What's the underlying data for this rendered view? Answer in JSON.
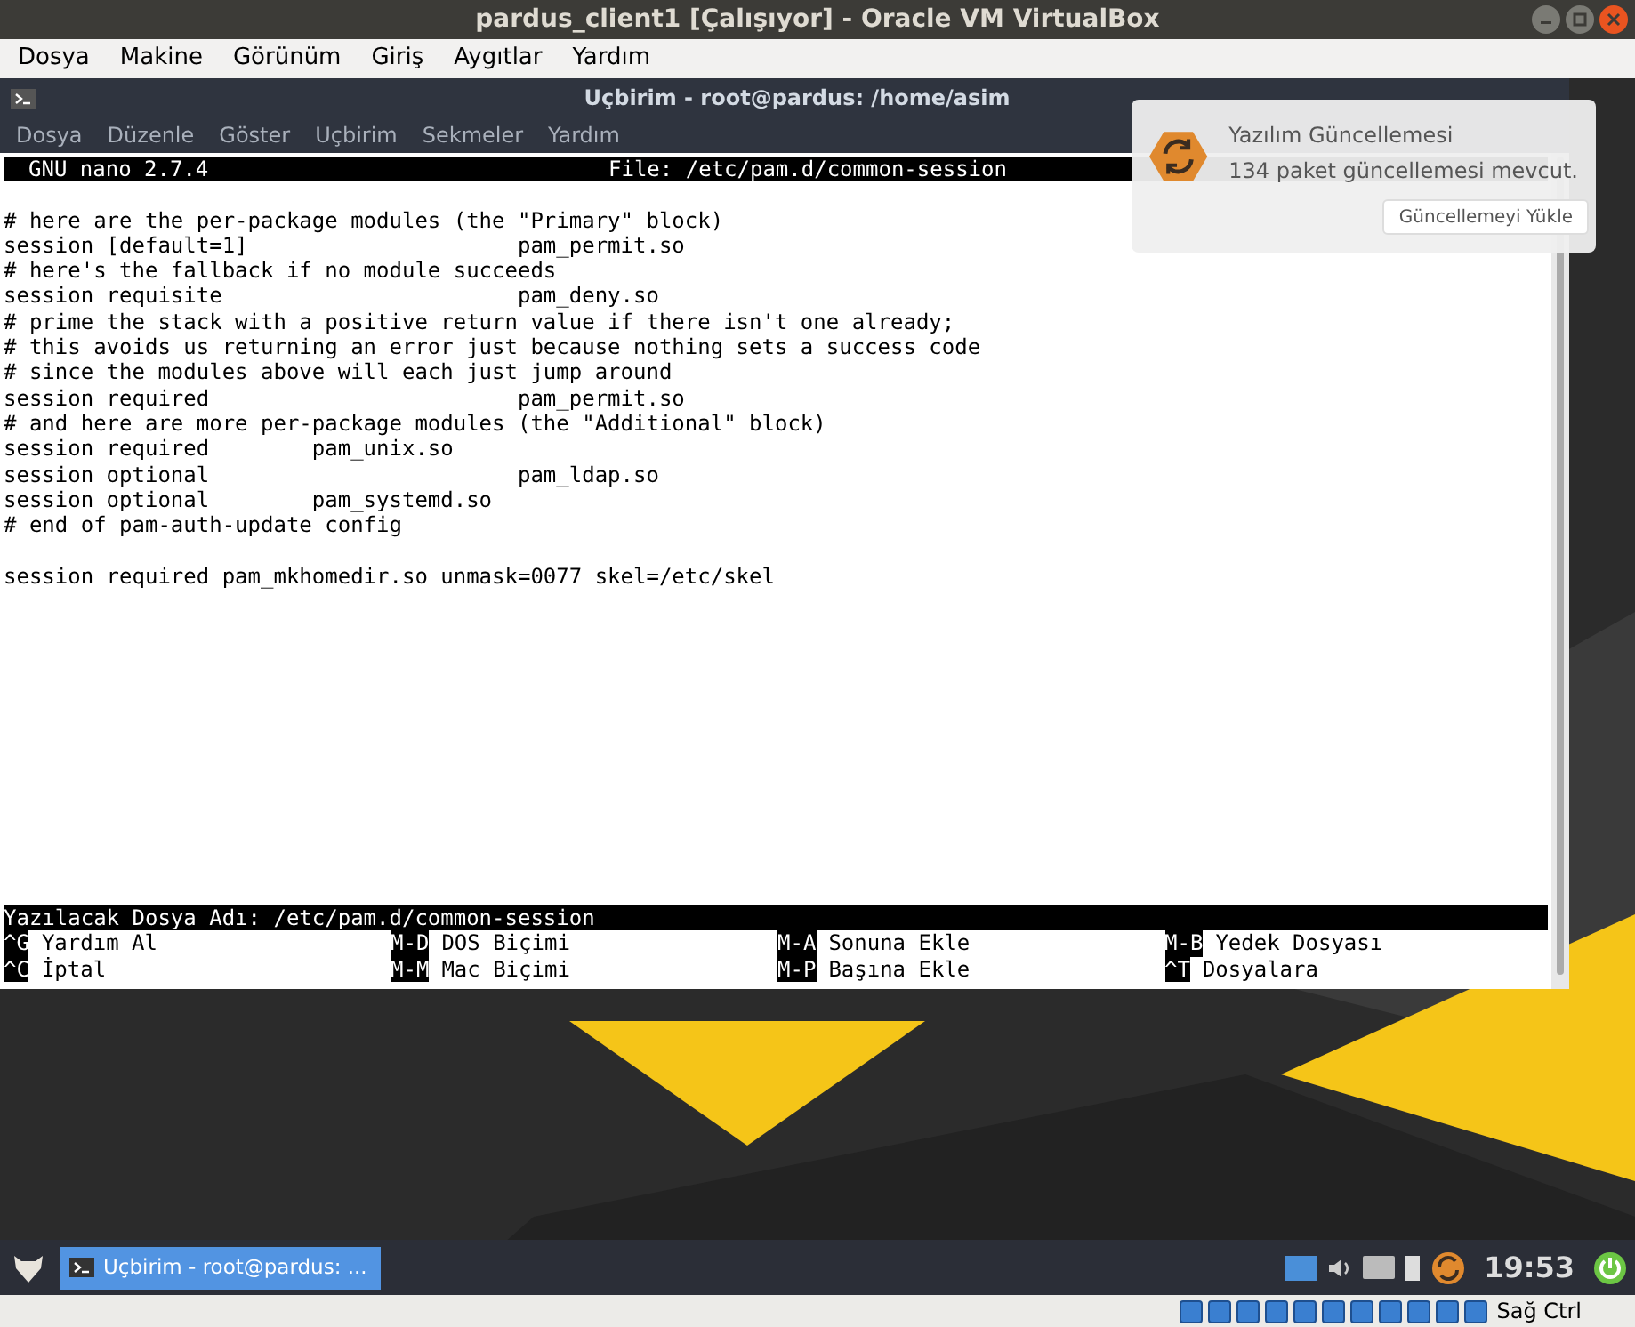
{
  "window": {
    "title": "pardus_client1 [Çalışıyor] - Oracle VM VirtualBox"
  },
  "menu": [
    "Dosya",
    "Makine",
    "Görünüm",
    "Giriş",
    "Aygıtlar",
    "Yardım"
  ],
  "terminal": {
    "title": "Uçbirim - root@pardus: /home/asim",
    "menu": [
      "Dosya",
      "Düzenle",
      "Göster",
      "Uçbirim",
      "Sekmeler",
      "Yardım"
    ]
  },
  "nano": {
    "version": "GNU nano 2.7.4",
    "file": "File: /etc/pam.d/common-session",
    "lines": [
      "# here are the per-package modules (the \"Primary\" block)",
      "session [default=1]                     pam_permit.so",
      "# here's the fallback if no module succeeds",
      "session requisite                       pam_deny.so",
      "# prime the stack with a positive return value if there isn't one already;",
      "# this avoids us returning an error just because nothing sets a success code",
      "# since the modules above will each just jump around",
      "session required                        pam_permit.so",
      "# and here are more per-package modules (the \"Additional\" block)",
      "session required        pam_unix.so",
      "session optional                        pam_ldap.so",
      "session optional        pam_systemd.so",
      "# end of pam-auth-update config"
    ],
    "last_line": "session required pam_mkhomedir.so unmask=0077 skel=/etc/skel",
    "prompt": "Yazılacak Dosya Adı: /etc/pam.d/common-session",
    "shortcuts": [
      {
        "key": "^G",
        "label": "Yardım Al"
      },
      {
        "key": "M-D",
        "label": "DOS Biçimi"
      },
      {
        "key": "M-A",
        "label": "Sonuna Ekle"
      },
      {
        "key": "M-B",
        "label": "Yedek Dosyası"
      },
      {
        "key": "^C",
        "label": "İptal"
      },
      {
        "key": "M-M",
        "label": "Mac Biçimi"
      },
      {
        "key": "M-P",
        "label": "Başına Ekle"
      },
      {
        "key": "^T",
        "label": "Dosyalara"
      }
    ]
  },
  "notification": {
    "title": "Yazılım Güncellemesi",
    "message": "134 paket güncellemesi mevcut.",
    "button": "Güncellemeyi Yükle"
  },
  "taskbar": {
    "task": "Uçbirim - root@pardus: ...",
    "clock": "19:53"
  },
  "status_bar": {
    "host_key": "Sağ Ctrl"
  }
}
